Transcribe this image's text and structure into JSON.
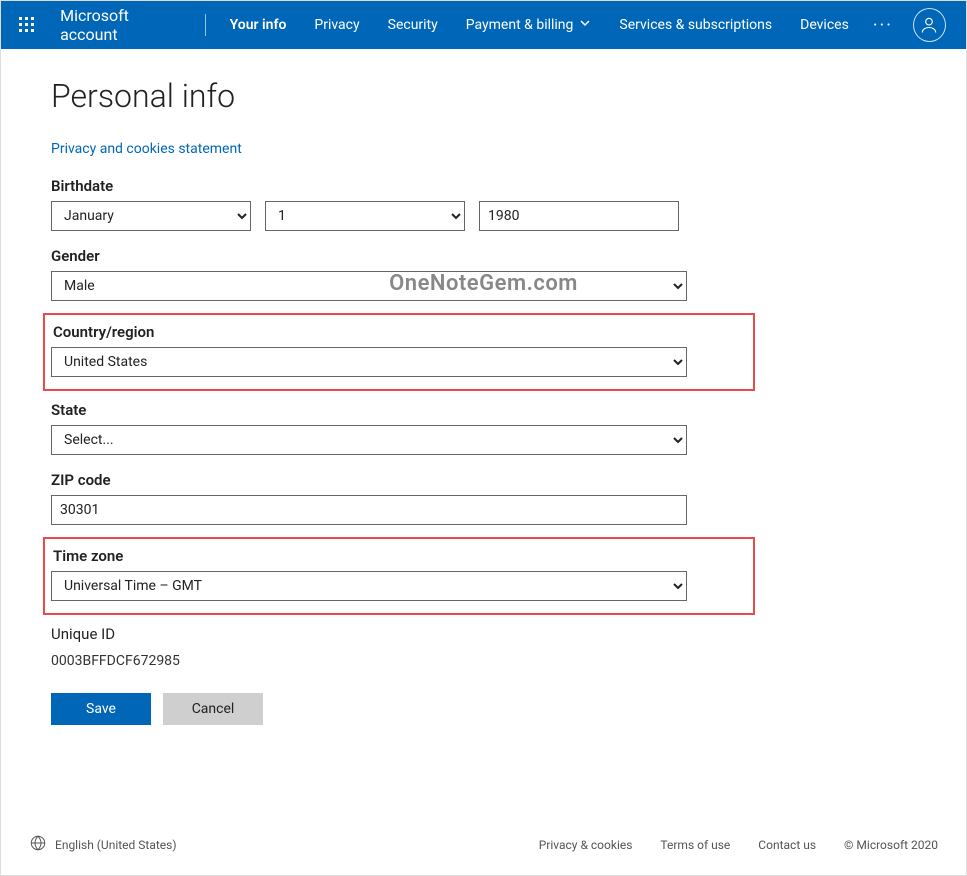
{
  "header": {
    "brand": "Microsoft account",
    "nav": [
      {
        "label": "Your info",
        "active": true
      },
      {
        "label": "Privacy"
      },
      {
        "label": "Security"
      },
      {
        "label": "Payment & billing",
        "dropdown": true
      },
      {
        "label": "Services & subscriptions"
      },
      {
        "label": "Devices"
      }
    ]
  },
  "page": {
    "title": "Personal info",
    "privacy_link": "Privacy and cookies statement"
  },
  "form": {
    "birthdate_label": "Birthdate",
    "birthdate_month": "January",
    "birthdate_day": "1",
    "birthdate_year": "1980",
    "gender_label": "Gender",
    "gender_value": "Male",
    "country_label": "Country/region",
    "country_value": "United States",
    "state_label": "State",
    "state_value": "Select...",
    "zip_label": "ZIP code",
    "zip_value": "30301",
    "timezone_label": "Time zone",
    "timezone_value": "Universal Time – GMT",
    "uniqueid_label": "Unique ID",
    "uniqueid_value": "0003BFFDCF672985",
    "save_label": "Save",
    "cancel_label": "Cancel"
  },
  "watermark": "OneNoteGem.com",
  "footer": {
    "language": "English (United States)",
    "links": {
      "privacy": "Privacy & cookies",
      "terms": "Terms of use",
      "contact": "Contact us"
    },
    "copyright": "© Microsoft 2020"
  }
}
